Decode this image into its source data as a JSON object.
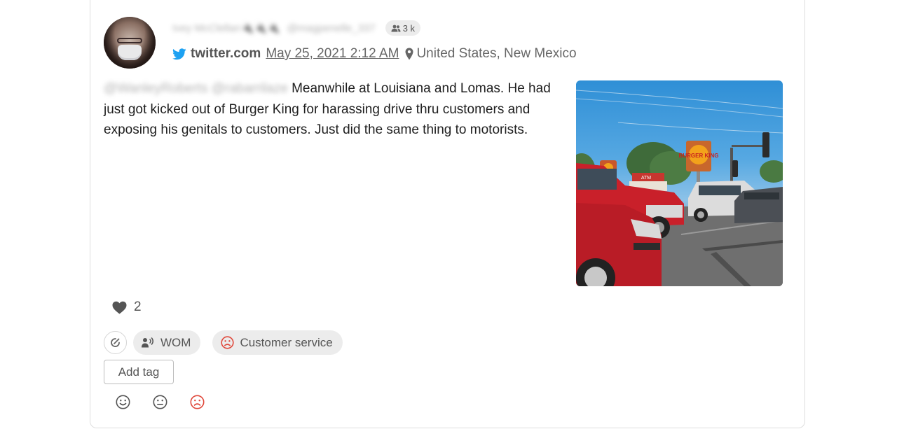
{
  "post": {
    "author_name": "Ivey McClellan🔌🔌🔌",
    "author_handle": "@magpenelle_337",
    "followers": "3 k",
    "source": "twitter.com",
    "date": "May 25, 2021 2:12 AM",
    "location": "United States, New Mexico",
    "mentions": "@WanleyRoberts @rabarrilaze",
    "text": "Meanwhile at Louisiana and Lomas. He had just got kicked out of Burger King for harassing drive thru customers and exposing his genitals to customers. Just did the same thing to motorists.",
    "likes": "2"
  },
  "tags": [
    {
      "label": "WOM",
      "icon": "megaphone-user-icon"
    },
    {
      "label": "Customer service",
      "icon": "sad-face-icon"
    }
  ],
  "add_tag_label": "Add tag",
  "sentiment_icons": [
    "positive-face-icon",
    "neutral-face-icon",
    "negative-face-icon"
  ],
  "media_sign": {
    "brand": "BURGER KING",
    "atm": "ATM"
  },
  "colors": {
    "twitter_blue": "#1da1f2",
    "negative_red": "#e0483b",
    "chip_bg": "#ececec",
    "text_gray": "#666666"
  }
}
